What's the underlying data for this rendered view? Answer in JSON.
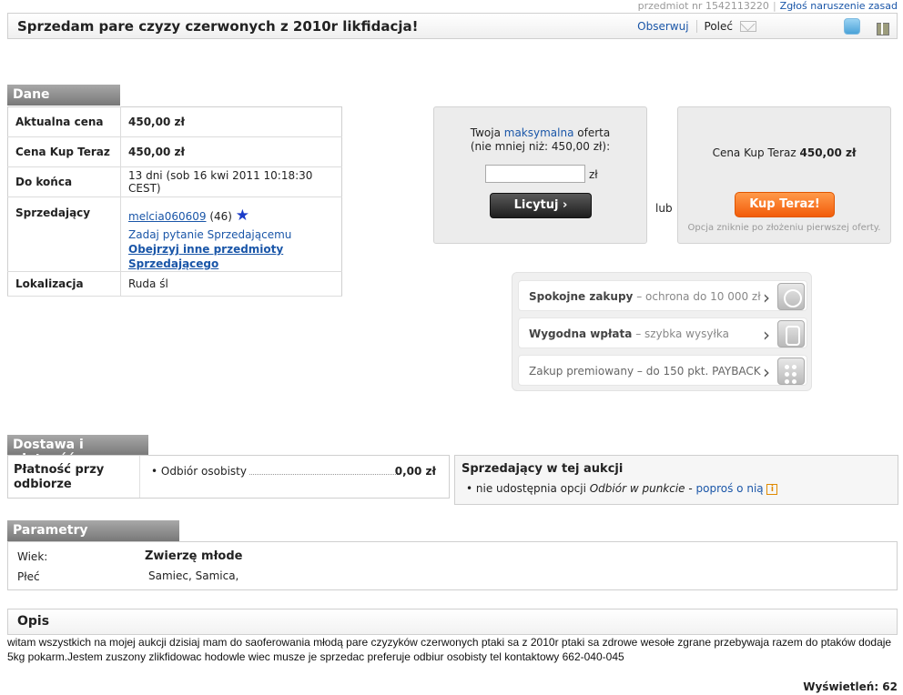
{
  "top": {
    "item_number": "przedmiot nr 1542113220",
    "report_link": "Zgłoś naruszenie zasad"
  },
  "title": "Sprzedam pare czyzy czerwonych z 2010r likfidacja!",
  "toolbar": {
    "observe": "Obserwuj",
    "recommend": "Poleć"
  },
  "dane": {
    "header": "Dane",
    "rows": {
      "current_price_label": "Aktualna cena",
      "current_price": "450,00 zł",
      "buy_now_label": "Cena Kup Teraz",
      "buy_now_price": "450,00 zł",
      "end_label": "Do końca",
      "end_value": "13 dni (sob 16 kwi 2011 10:18:30 CEST)",
      "seller_label": "Sprzedający",
      "seller_name": "melcia060609",
      "seller_rating": "(46)",
      "ask_seller": "Zadaj pytanie Sprzedającemu",
      "other_items": "Obejrzyj inne przedmioty Sprzedającego",
      "location_label": "Lokalizacja",
      "location": "Ruda śl"
    }
  },
  "bid": {
    "line1_pre": "Twoja",
    "line1_link": "maksymalna",
    "line1_post": "oferta",
    "line2": "(nie mniej niż: 450,00 zł):",
    "unit": "zł",
    "button": "Licytuj ›"
  },
  "or": "lub",
  "buy": {
    "label": "Cena Kup Teraz",
    "price": "450,00 zł",
    "button": "Kup Teraz!",
    "note": "Opcja zniknie po złożeniu pierwszej oferty."
  },
  "benefits": [
    {
      "bold": "Spokojne zakupy",
      "rest": " – ochrona do 10 000 zł",
      "icon": "umbrella-icon"
    },
    {
      "bold": "Wygodna wpłata",
      "rest": " – szybka wysyłka",
      "icon": "hand-icon"
    },
    {
      "bold": "",
      "rest": "Zakup premiowany – do 150 pkt. PAYBACK",
      "icon": "payback-icon"
    }
  ],
  "dostawa": {
    "header": "Dostawa i płatność",
    "label": "Płatność przy odbiorze",
    "option": "Odbiór osobisty",
    "price": "0,00 zł",
    "seller_title": "Sprzedający w tej aukcji",
    "seller_item_pre": "nie udostępnia opcji",
    "seller_item_em": "Odbiór w punkcie",
    "seller_item_dash": " - ",
    "seller_item_link": "poproś o nią"
  },
  "params": {
    "header": "Parametry",
    "age_label": "Wiek:",
    "age_value": "Zwierzę młode",
    "sex_label": "Płeć",
    "sex_value": "Samiec, Samica,"
  },
  "opis": {
    "header": "Opis",
    "text": "witam wszystkich na mojej aukcji dzisiaj mam do saoferowania młodą pare czyzyków czerwonych ptaki sa z 2010r ptaki sa zdrowe wesołe zgrane przebywaja razem do ptaków dodaje 5kg pokarm.Jestem zuszony zlikfidowac hodowle wiec musze je sprzedac preferuje odbiur osobisty tel kontaktowy 662-040-045"
  },
  "views": "Wyświetleń: 62"
}
